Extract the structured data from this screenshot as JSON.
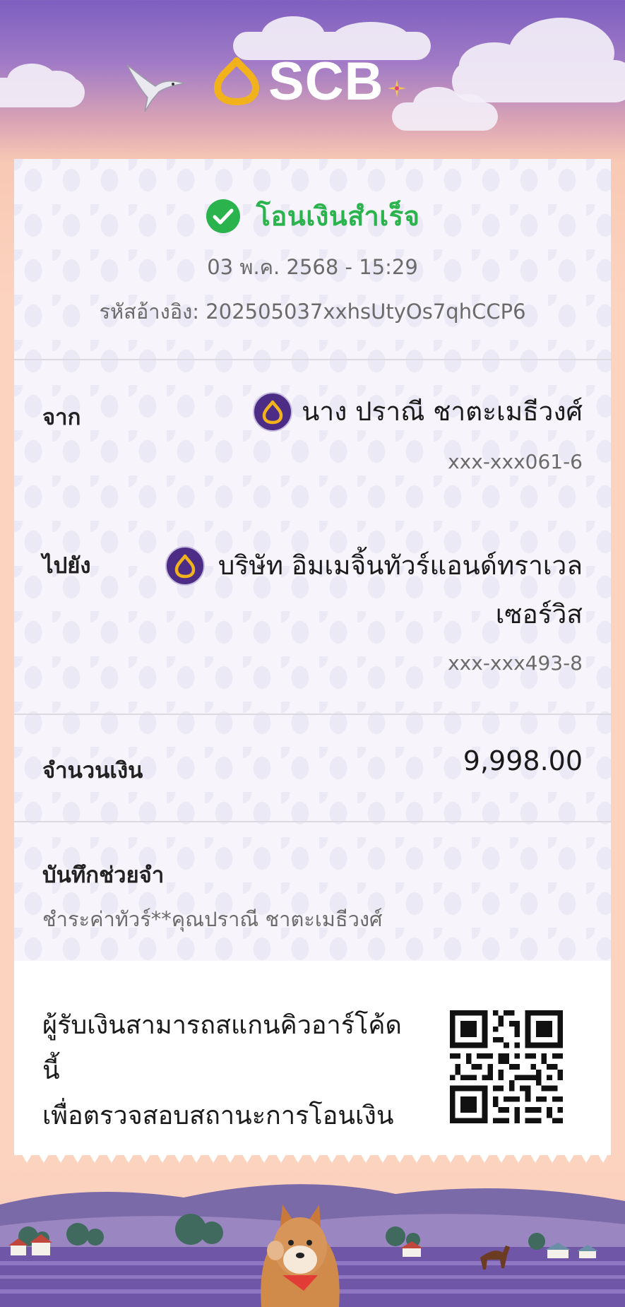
{
  "header": {
    "brand": "SCB",
    "colors": {
      "sky_top": "#7d5fc0",
      "brand_gold": "#f2b21b",
      "brand_purple": "#4d2c85"
    }
  },
  "receipt": {
    "status": "โอนเงินสำเร็จ",
    "datetime": "03 พ.ค. 2568 - 15:29",
    "reference": "รหัสอ้างอิง: 202505037xxhsUtyOs7qhCCP6",
    "from": {
      "label": "จาก",
      "name": "นาง ปราณี ชาตะเมธีวงศ์",
      "account": "xxx-xxx061-6",
      "bank_icon": "scb-bank-icon"
    },
    "to": {
      "label": "ไปยัง",
      "name_line1": "บริษัท อิมเมจิ้นทัวร์แอนด์ทราเวล",
      "name_line2": "เซอร์วิส",
      "account": "xxx-xxx493-8",
      "bank_icon": "scb-bank-icon"
    },
    "amount": {
      "label": "จำนวนเงิน",
      "value": "9,998.00"
    },
    "memo": {
      "label": "บันทึกช่วยจำ",
      "value": "ชำระค่าทัวร์**คุณปราณี ชาตะเมธีวงศ์"
    },
    "qr": {
      "note_line1": "ผู้รับเงินสามารถสแกนคิวอาร์โค้ดนี้",
      "note_line2": "เพื่อตรวจสอบสถานะการโอนเงิน",
      "icon": "qr-code-icon"
    },
    "colors": {
      "success": "#2bb34e",
      "muted_text": "#6b6b6b"
    }
  }
}
